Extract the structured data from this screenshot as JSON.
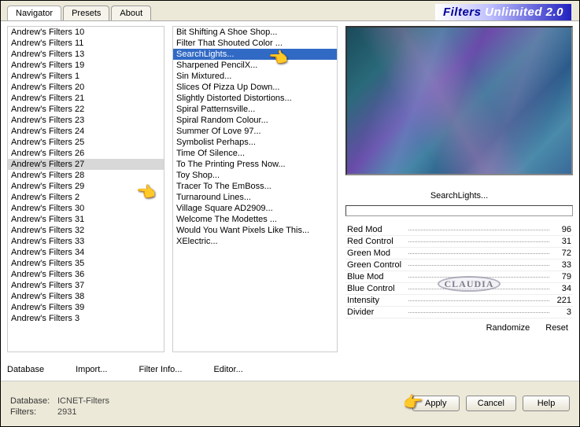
{
  "brand": {
    "pre": "Filters ",
    "post": "Unlimited 2.0"
  },
  "tabs": [
    {
      "label": "Navigator",
      "active": true
    },
    {
      "label": "Presets",
      "active": false
    },
    {
      "label": "About",
      "active": false
    }
  ],
  "leftList": {
    "selectedIndex": 12,
    "items": [
      "Andrew's Filters 10",
      "Andrew's Filters 11",
      "Andrew's Filters 13",
      "Andrew's Filters 19",
      "Andrew's Filters 1",
      "Andrew's Filters 20",
      "Andrew's Filters 21",
      "Andrew's Filters 22",
      "Andrew's Filters 23",
      "Andrew's Filters 24",
      "Andrew's Filters 25",
      "Andrew's Filters 26",
      "Andrew's Filters 27",
      "Andrew's Filters 28",
      "Andrew's Filters 29",
      "Andrew's Filters 2",
      "Andrew's Filters 30",
      "Andrew's Filters 31",
      "Andrew's Filters 32",
      "Andrew's Filters 33",
      "Andrew's Filters 34",
      "Andrew's Filters 35",
      "Andrew's Filters 36",
      "Andrew's Filters 37",
      "Andrew's Filters 38",
      "Andrew's Filters 39",
      "Andrew's Filters 3"
    ]
  },
  "midList": {
    "selectedIndex": 2,
    "items": [
      "Bit Shifting A Shoe Shop...",
      "Filter That Shouted Color ...",
      "SearchLights...",
      "Sharpened PencilX...",
      "Sin Mixtured...",
      "Slices Of Pizza Up Down...",
      "Slightly Distorted Distortions...",
      "Spiral Patternsville...",
      "Spiral Random Colour...",
      "Summer Of Love 97...",
      "Symbolist Perhaps...",
      "Time Of Silence...",
      "To The Printing Press Now...",
      "Toy Shop...",
      "Tracer To The EmBoss...",
      "Turnaround Lines...",
      "Village Square AD2909...",
      "Welcome The Modettes ...",
      "Would You Want Pixels Like This...",
      "XElectric..."
    ]
  },
  "preview": {
    "filterName": "SearchLights..."
  },
  "params": [
    {
      "label": "Red Mod",
      "value": "96"
    },
    {
      "label": "Red Control",
      "value": "31"
    },
    {
      "label": "Green Mod",
      "value": "72"
    },
    {
      "label": "Green Control",
      "value": "33"
    },
    {
      "label": "Blue Mod",
      "value": "79"
    },
    {
      "label": "Blue Control",
      "value": "34"
    },
    {
      "label": "Intensity",
      "value": "221"
    },
    {
      "label": "Divider",
      "value": "3"
    }
  ],
  "rightButtons": {
    "randomize": "Randomize",
    "reset": "Reset"
  },
  "bottomLinks": {
    "database": "Database",
    "import": "Import...",
    "filterInfo": "Filter Info...",
    "editor": "Editor..."
  },
  "footer": {
    "dbLabel": "Database:",
    "dbValue": "ICNET-Filters",
    "filtersLabel": "Filters:",
    "filtersValue": "2931",
    "apply": "Apply",
    "cancel": "Cancel",
    "help": "Help"
  },
  "watermark": "CLAUDIA"
}
